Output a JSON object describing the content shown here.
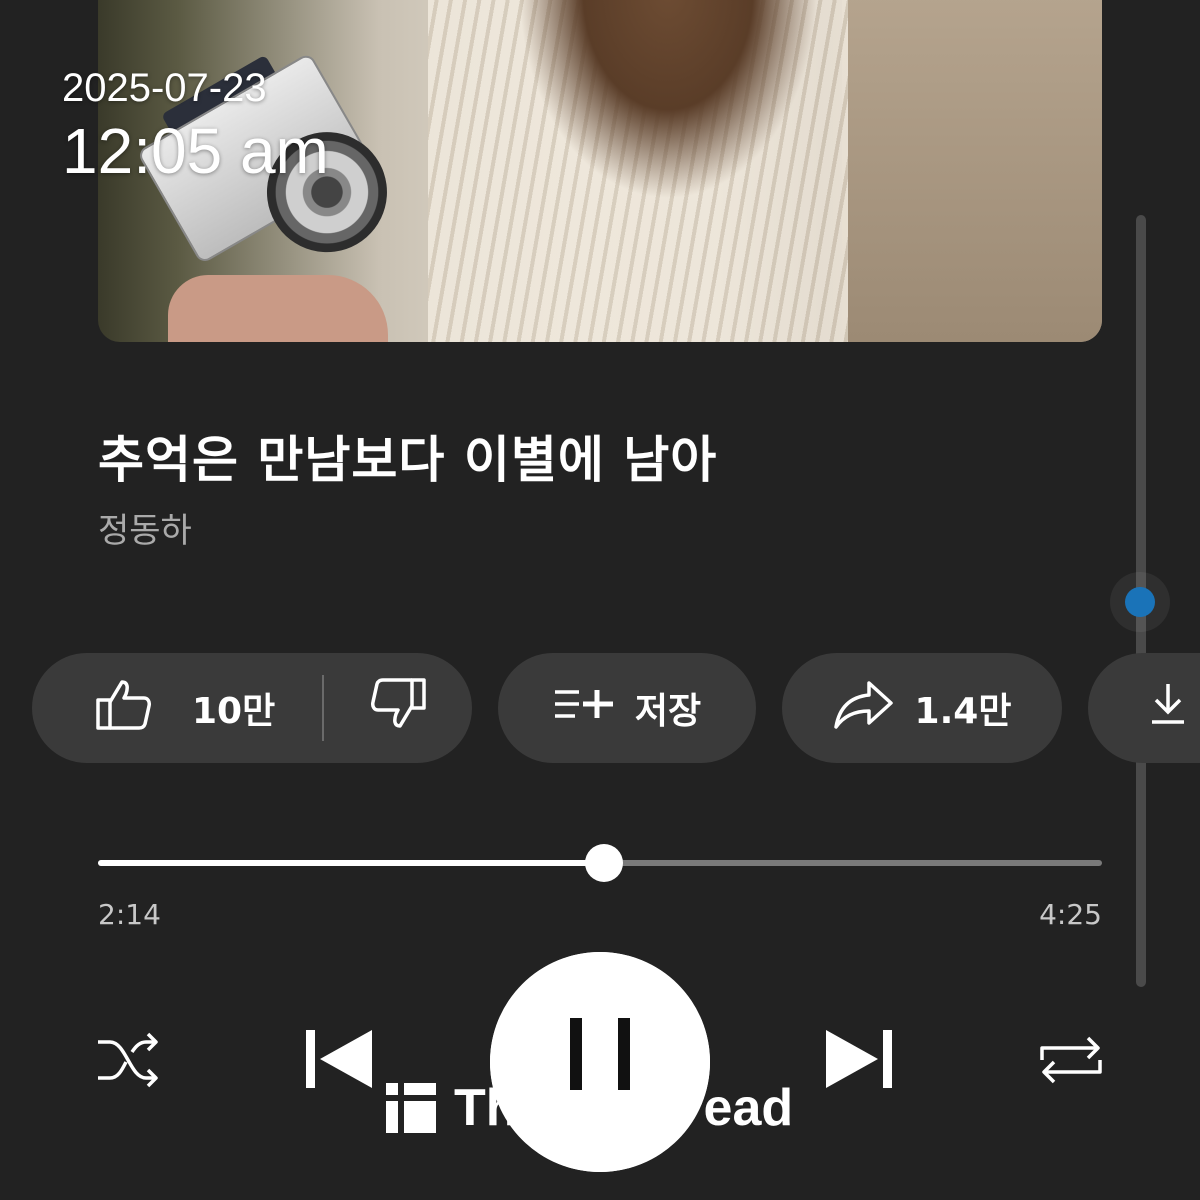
{
  "overlay": {
    "date": "2025-07-23",
    "time": "12:05 am"
  },
  "song": {
    "title": "추억은 만남보다 이별에 남아",
    "artist": "정동하"
  },
  "actions": {
    "like_count": "10만",
    "save_label": "저장",
    "share_count": "1.4만"
  },
  "player": {
    "current_time": "2:14",
    "total_time": "4:25",
    "progress_fraction": 0.504
  },
  "scroll": {
    "position_fraction": 0.5
  },
  "watermark": {
    "text": "The Read",
    "visible_prefix": "Th",
    "visible_suffix": "ead"
  },
  "icons": {
    "like": "thumbs-up-icon",
    "dislike": "thumbs-down-icon",
    "save": "playlist-add-icon",
    "share": "share-arrow-icon",
    "download": "download-icon",
    "shuffle": "shuffle-icon",
    "previous": "skip-previous-icon",
    "pause": "pause-icon",
    "next": "skip-next-icon",
    "repeat": "repeat-icon"
  },
  "colors": {
    "background": "#222222",
    "pill": "#3a3a3a",
    "scroll_thumb": "#1a73b8"
  }
}
